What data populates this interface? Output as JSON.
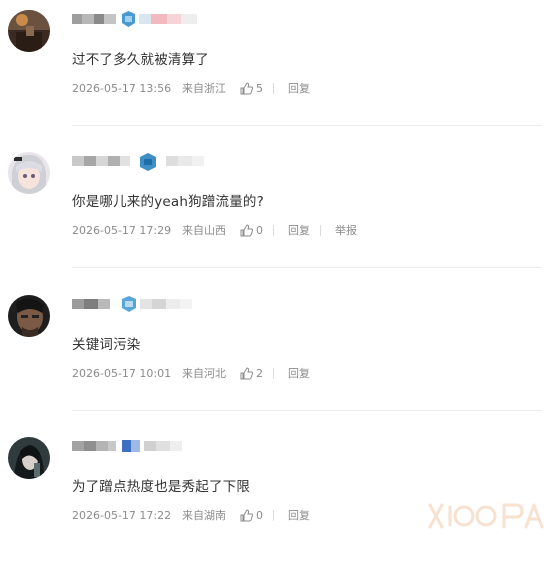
{
  "comments": [
    {
      "text": "过不了多久就被清算了",
      "time": "2026-05-17 13:56",
      "location": "来自浙江",
      "likes": "5",
      "reply_label": "回复",
      "report_label": ""
    },
    {
      "text": "你是哪儿来的yeah狗蹭流量的?",
      "time": "2026-05-17 17:29",
      "location": "来自山西",
      "likes": "0",
      "reply_label": "回复",
      "report_label": "举报"
    },
    {
      "text": "关键词污染",
      "time": "2026-05-17 10:01",
      "location": "来自河北",
      "likes": "2",
      "reply_label": "回复",
      "report_label": ""
    },
    {
      "text": "为了蹭点热度也是秀起了下限",
      "time": "2026-05-17 17:22",
      "location": "来自湖南",
      "likes": "0",
      "reply_label": "回复",
      "report_label": ""
    }
  ],
  "colors": {
    "meta_text": "#8b8b8b",
    "divider": "#ececec",
    "badge_blue": "#3f8fc7"
  }
}
